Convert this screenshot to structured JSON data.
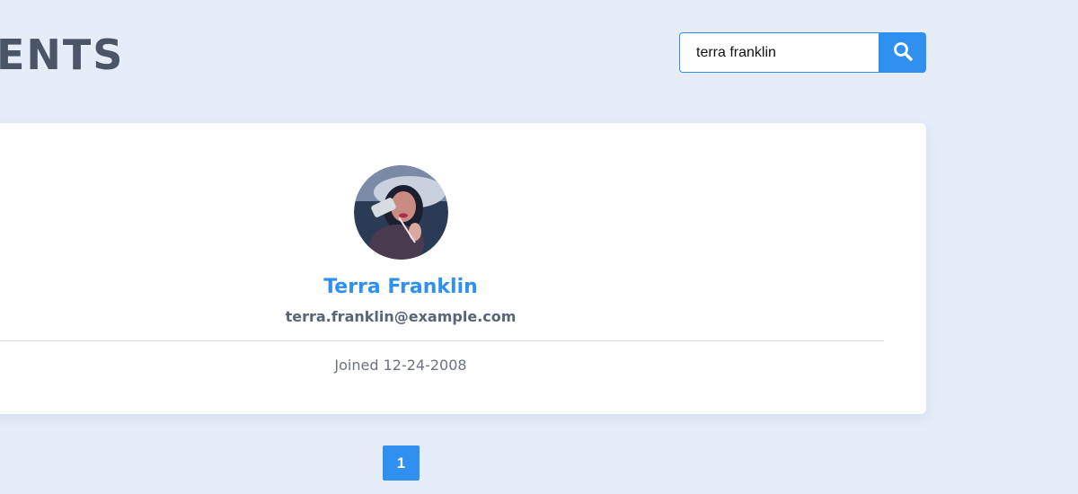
{
  "header": {
    "title": "ENTS"
  },
  "search": {
    "value": "terra franklin",
    "button_icon": "search-icon"
  },
  "user": {
    "name": "Terra Franklin",
    "email": "terra.franklin@example.com",
    "joined": "Joined 12-24-2008",
    "avatar": "avatar-photo"
  },
  "pagination": {
    "pages": [
      "1"
    ]
  },
  "colors": {
    "accent": "#2f90ef",
    "background": "#e5edf8",
    "title": "#4a5568"
  }
}
